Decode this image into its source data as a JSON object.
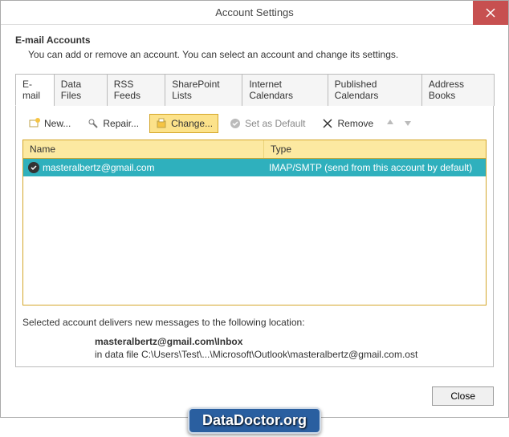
{
  "window": {
    "title": "Account Settings"
  },
  "header": {
    "title": "E-mail Accounts",
    "subtitle": "You can add or remove an account. You can select an account and change its settings."
  },
  "tabs": [
    {
      "label": "E-mail"
    },
    {
      "label": "Data Files"
    },
    {
      "label": "RSS Feeds"
    },
    {
      "label": "SharePoint Lists"
    },
    {
      "label": "Internet Calendars"
    },
    {
      "label": "Published Calendars"
    },
    {
      "label": "Address Books"
    }
  ],
  "toolbar": {
    "new_label": "New...",
    "repair_label": "Repair...",
    "change_label": "Change...",
    "default_label": "Set as Default",
    "remove_label": "Remove"
  },
  "list": {
    "headers": {
      "name": "Name",
      "type": "Type"
    },
    "rows": [
      {
        "name": "masteralbertz@gmail.com",
        "type": "IMAP/SMTP (send from this account by default)"
      }
    ]
  },
  "selected": {
    "desc": "Selected account delivers new messages to the following location:",
    "location": "masteralbertz@gmail.com\\Inbox",
    "file": "in data file C:\\Users\\Test\\...\\Microsoft\\Outlook\\masteralbertz@gmail.com.ost"
  },
  "footer": {
    "close_label": "Close"
  },
  "watermark": {
    "text": "DataDoctor.org"
  }
}
